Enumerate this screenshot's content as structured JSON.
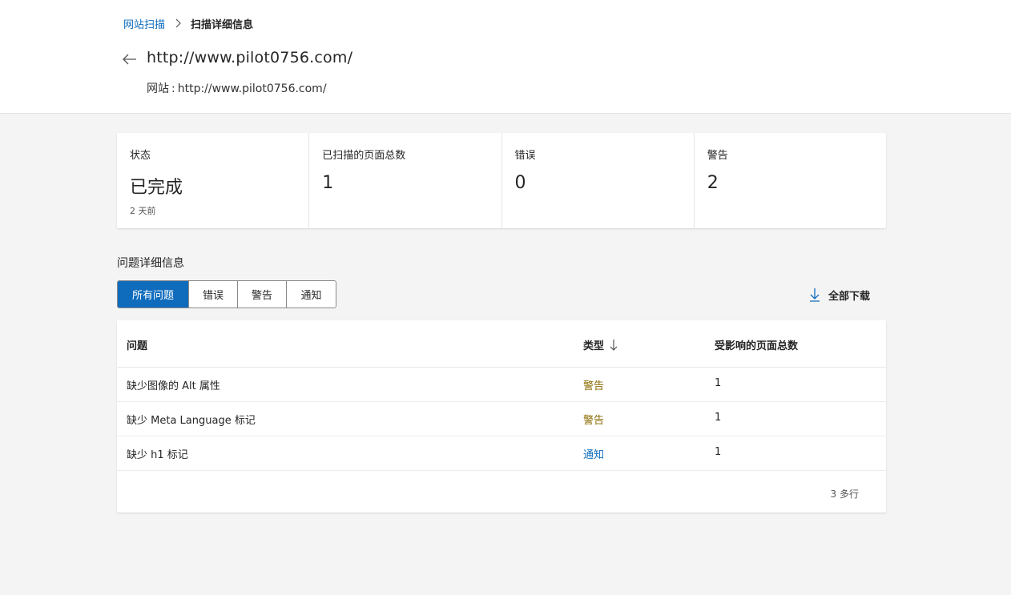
{
  "breadcrumb": {
    "parent": "网站扫描",
    "current": "扫描详细信息"
  },
  "header": {
    "title": "http://www.pilot0756.com/",
    "subtitle_label": "网站",
    "subtitle_colon": ":",
    "subtitle_value": "http://www.pilot0756.com/"
  },
  "stats": [
    {
      "label": "状态",
      "value": "已完成",
      "note": "2 天前"
    },
    {
      "label": "已扫描的页面总数",
      "value": "1"
    },
    {
      "label": "错误",
      "value": "0"
    },
    {
      "label": "警告",
      "value": "2"
    }
  ],
  "issues": {
    "section_title": "问题详细信息",
    "tabs": [
      {
        "label": "所有问题",
        "active": true
      },
      {
        "label": "错误",
        "active": false
      },
      {
        "label": "警告",
        "active": false
      },
      {
        "label": "通知",
        "active": false
      }
    ],
    "download_label": "全部下载",
    "columns": {
      "issue": "问题",
      "type": "类型",
      "pages": "受影响的页面总数"
    },
    "rows": [
      {
        "issue": "缺少图像的 Alt 属性",
        "type": "警告",
        "kind": "warning",
        "pages": "1"
      },
      {
        "issue": "缺少 Meta Language 标记",
        "type": "警告",
        "kind": "warning",
        "pages": "1"
      },
      {
        "issue": "缺少 h1 标记",
        "type": "通知",
        "kind": "notice",
        "pages": "1"
      }
    ],
    "row_count": "3 多行"
  },
  "icons": {
    "breadcrumb_separator": "chevron-right-icon",
    "back": "arrow-left-icon",
    "download": "arrow-down-icon",
    "sort": "sort-descending-icon"
  },
  "colors": {
    "accent": "#0f6cbd",
    "warning_text": "#8a6a00",
    "notice_text": "#0f6cbd"
  }
}
